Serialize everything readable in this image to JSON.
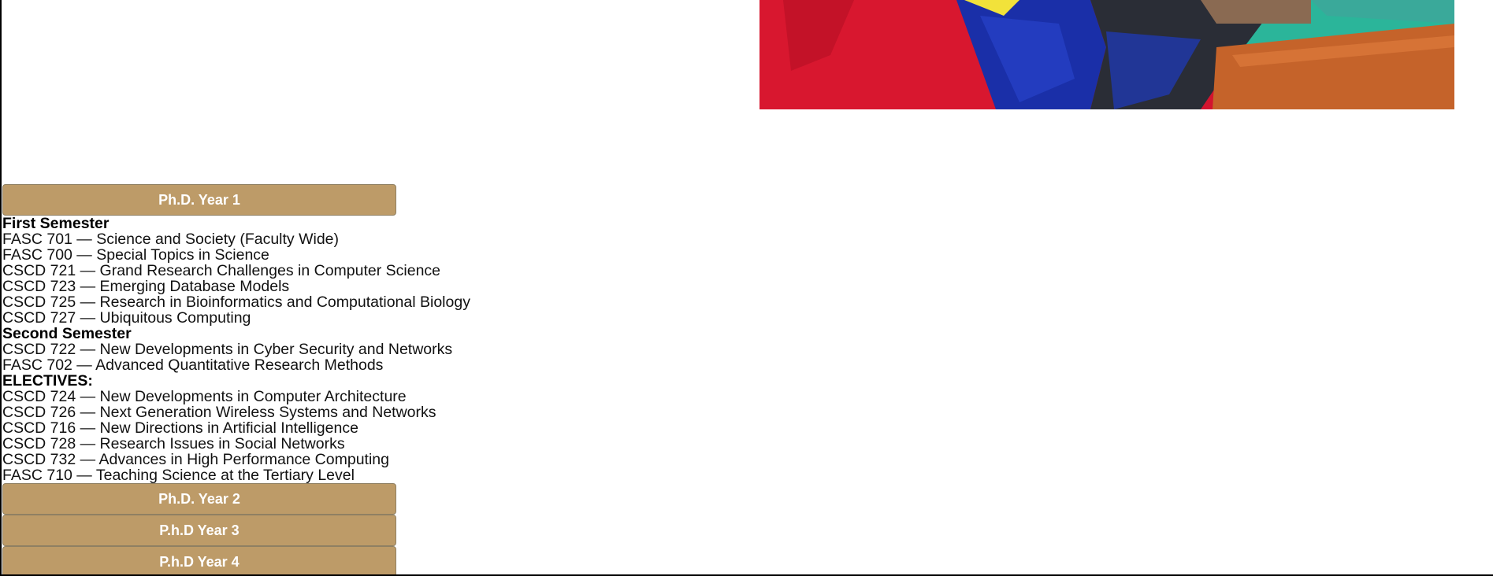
{
  "hero": {
    "image_name": "graduation-photo",
    "colors": {
      "red": "#d3142f",
      "blue": "#1a2fa8",
      "dark": "#2a2d36",
      "orange": "#c5632a",
      "teal": "#2bb59a"
    }
  },
  "accordion": {
    "sections": [
      {
        "label": "Ph.D. Year 1",
        "expanded": true,
        "groups": [
          {
            "heading": "First Semester",
            "courses": [
              "FASC 701 — Science and Society (Faculty Wide)",
              "FASC 700 — Special Topics in Science",
              "CSCD 721 — Grand Research Challenges in Computer Science",
              "CSCD 723 — Emerging Database Models",
              "CSCD 725 — Research in Bioinformatics and Computational Biology",
              "CSCD 727 — Ubiquitous Computing"
            ]
          },
          {
            "heading": "Second Semester",
            "courses": [
              "CSCD 722 — New Developments in Cyber Security and Networks",
              "FASC 702 — Advanced Quantitative Research Methods"
            ]
          },
          {
            "heading": "ELECTIVES:",
            "courses": [
              "CSCD 724 — New Developments in Computer Architecture",
              "CSCD 726 — Next Generation Wireless Systems and Networks",
              "CSCD 716 — New Directions in Artificial Intelligence",
              "CSCD 728 — Research Issues in Social Networks",
              "CSCD 732 — Advances in High Performance Computing",
              "FASC 710 — Teaching Science at the Tertiary Level"
            ]
          }
        ]
      },
      {
        "label": "Ph.D. Year 2",
        "expanded": false
      },
      {
        "label": "P.h.D Year 3",
        "expanded": false
      },
      {
        "label": "P.h.D Year 4",
        "expanded": false
      }
    ]
  }
}
